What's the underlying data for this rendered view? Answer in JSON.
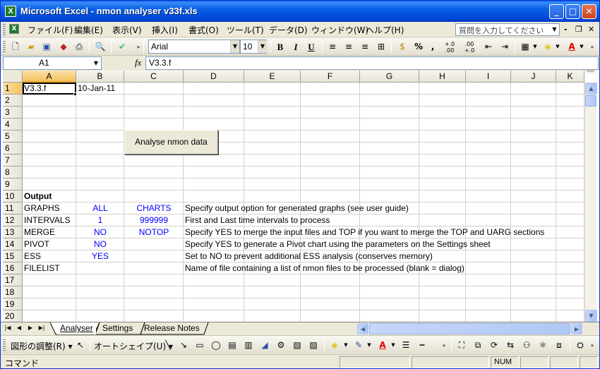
{
  "window": {
    "title": "Microsoft Excel - nmon analyser v33f.xls",
    "app_icon": "excel-icon",
    "controls": {
      "minimize": "_",
      "maximize": "□",
      "close": "✕"
    }
  },
  "menubar": {
    "items": [
      "ファイル(F)",
      "編集(E)",
      "表示(V)",
      "挿入(I)",
      "書式(O)",
      "ツール(T)",
      "データ(D)",
      "ウィンドウ(W)",
      "ヘルプ(H)"
    ],
    "help_placeholder": "質問を入力してください",
    "mdi": {
      "minimize": "-",
      "restore": "❐",
      "close": "✕"
    }
  },
  "toolbar": {
    "font_name": "Arial",
    "font_size": "10",
    "bold": "B",
    "italic": "I",
    "underline": "U",
    "percent": "%",
    "comma": ",",
    "inc_decimal": "+.0 .00",
    "dec_decimal": ".00 +.0"
  },
  "formula_bar": {
    "name_box": "A1",
    "fx": "fx",
    "formula": "V3.3.f"
  },
  "grid": {
    "columns": [
      "A",
      "B",
      "C",
      "D",
      "E",
      "F",
      "G",
      "H",
      "I",
      "J",
      "K"
    ],
    "selected_column": "A",
    "rows": [
      "1",
      "2",
      "3",
      "4",
      "5",
      "6",
      "7",
      "8",
      "9",
      "10",
      "11",
      "12",
      "13",
      "14",
      "15",
      "16",
      "17",
      "18",
      "19",
      "20"
    ],
    "selected_row": "1",
    "cells": {
      "A1": "V3.3.f",
      "B1": "10-Jan-11",
      "A10": "Output",
      "A11": "GRAPHS",
      "B11": "ALL",
      "C11": "CHARTS",
      "D11": "Specify output option for generated graphs (see user guide)",
      "A12": "INTERVALS",
      "B12": "1",
      "C12": "999999",
      "D12": "First and Last time intervals to process",
      "A13": "MERGE",
      "B13": "NO",
      "C13": "NOTOP",
      "D13": "Specify YES to merge the input files and TOP if you want to merge the TOP and UARG sections",
      "A14": "PIVOT",
      "B14": "NO",
      "D14": "Specify YES to generate a Pivot chart using the parameters on the Settings sheet",
      "A15": "ESS",
      "B15": "YES",
      "D15": "Set to NO to prevent additional ESS analysis (conserves memory)",
      "A16": "FILELIST",
      "D16": "Name of file containing a list of nmon files to be processed (blank = dialog)"
    },
    "macro_button": "Analyse nmon data"
  },
  "sheet_tabs": [
    "Analyser",
    "Settings",
    "Release Notes"
  ],
  "active_sheet": "Analyser",
  "drawbar": {
    "draw_menu": "図形の調整(R) ▾",
    "autoshape_menu": "オートシェイプ(U) ▾"
  },
  "statusbar": {
    "mode": "コマンド",
    "num_lock": "NUM"
  },
  "colors": {
    "title_blue": "#0A5FE4",
    "cell_blue_text": "#0000FF",
    "selected_header": "#F5C45F"
  }
}
